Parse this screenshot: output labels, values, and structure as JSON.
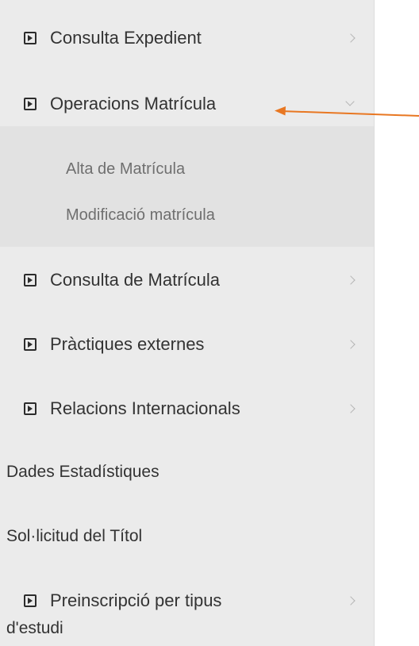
{
  "menu": {
    "consulta_expedient": "Consulta Expedient",
    "operacions_matricula": "Operacions Matrícula",
    "submenu": {
      "alta": "Alta de Matrícula",
      "modificacio": "Modificació matrícula"
    },
    "consulta_matricula": "Consulta de Matrícula",
    "practiques": "Pràctiques externes",
    "relacions": "Relacions Internacionals",
    "dades": "Dades Estadístiques",
    "sollicitud": "Sol·licitud del Títol",
    "preinscripcio_line1": "Preinscripció per tipus",
    "preinscripcio_line2": "d'estudi"
  },
  "colors": {
    "sidebar_bg": "#ebebeb",
    "submenu_bg": "#e2e2e2",
    "text": "#333333",
    "subtext": "#6f6f6f",
    "chevron": "#b5b5b5",
    "annotation_arrow": "#e87722"
  },
  "icons": {
    "item_icon": "play-square-icon",
    "collapsed": "chevron-right-icon",
    "expanded": "chevron-down-icon"
  }
}
